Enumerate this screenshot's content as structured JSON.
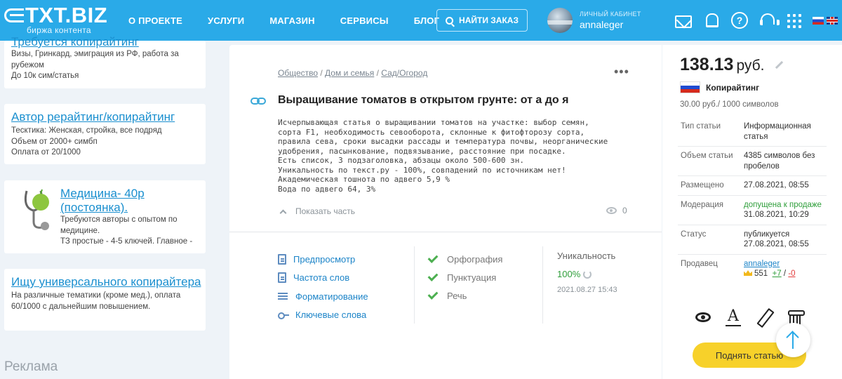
{
  "header": {
    "logo_text": "TXT.BIZ",
    "logo_sub": "биржа контента",
    "nav": [
      "О ПРОЕКТЕ",
      "УСЛУГИ",
      "МАГАЗИН",
      "СЕРВИСЫ",
      "БЛОГ"
    ],
    "find_button": "НАЙТИ ЗАКАЗ",
    "account_label": "ЛИЧНЫЙ КАБИНЕТ",
    "account_name": "annaleger",
    "help_glyph": "?",
    "brand_color": "#2aaae8"
  },
  "left_cards": [
    {
      "title": "Требуется копирайтинг",
      "lines": [
        "Визы, Гринкард, эмиграция из РФ, работа за рубежом",
        "До 10к сим/статья"
      ]
    },
    {
      "title": "Автор рерайтинг/копирайтинг",
      "lines": [
        "Тесктика: Женская, стройка, все подряд",
        "Объем от 2000+ симбп",
        "Оплата от 20/1000"
      ]
    },
    {
      "title": "Медицина- 40р (постоянка).",
      "lines": [
        "Требуются авторы с опытом по медицине.",
        "ТЗ простые - 4-5 ключей. Главное -"
      ]
    },
    {
      "title": "Ищу универсального копирайтера",
      "lines": [
        "На различные тематики (кроме мед.), оплата 60/1000 с дальнейшим повышением."
      ]
    }
  ],
  "ads_label": "Реклама",
  "article": {
    "breadcrumbs": [
      "Общество",
      "Дом и семья",
      "Сад/Огород"
    ],
    "breadcrumb_sep": " / ",
    "menu_glyph": "•••",
    "title": "Выращивание томатов в открытом грунте: от а до я",
    "description": "Исчерпывающая статья о выращивании томатов на участке: выбор семян,\nсорта F1, необходимость севооборота, склонные к фитофторозу сорта,\nправила сева, сроки высадки рассады и температура почвы, неорганические\nудобрения, пасынкование, подвязывание, расстояние при посадке.\nЕсть список, 3 подзаголовка, абзацы около 500-600 зн.\nУникальность по текст.ру - 100%, совпадений по источникам нет!\nАкадемическая тошнота по адвего 5,9 %\nВода по адвего 64, 3%",
    "show_part": "Показать часть",
    "views": "0",
    "tools": [
      "Предпросмотр",
      "Частота слов",
      "Форматирование",
      "Ключевые слова"
    ],
    "checks": [
      "Орфография",
      "Пунктуация",
      "Речь"
    ],
    "uniqueness_label": "Уникальность",
    "uniqueness_value": "100%",
    "uniqueness_date": "2021.08.27 15:43"
  },
  "side": {
    "price": "138.13",
    "currency": "руб.",
    "category": "Копирайтинг",
    "rate": "30.00 руб./ 1000 символов",
    "info": [
      {
        "key": "Тип статьи",
        "value": "Информационная статья"
      },
      {
        "key": "Объем статьи",
        "value": "4385 символов без пробелов"
      },
      {
        "key": "Размещено",
        "value": "27.08.2021, 08:55"
      },
      {
        "key": "Модерация",
        "value_green": "допущена к продаже",
        "value": "31.08.2021, 10:29"
      },
      {
        "key": "Статус",
        "value": "публикуется 27.08.2021, 08:55"
      }
    ],
    "seller_key": "Продавец",
    "seller_name": "annaleger",
    "seller_rating": "551",
    "seller_plus": "+7",
    "seller_minus": "-0",
    "seller_sep": "/",
    "font_glyph": "A",
    "raise_button": "Поднять статью",
    "button_color": "#f7d12a"
  }
}
